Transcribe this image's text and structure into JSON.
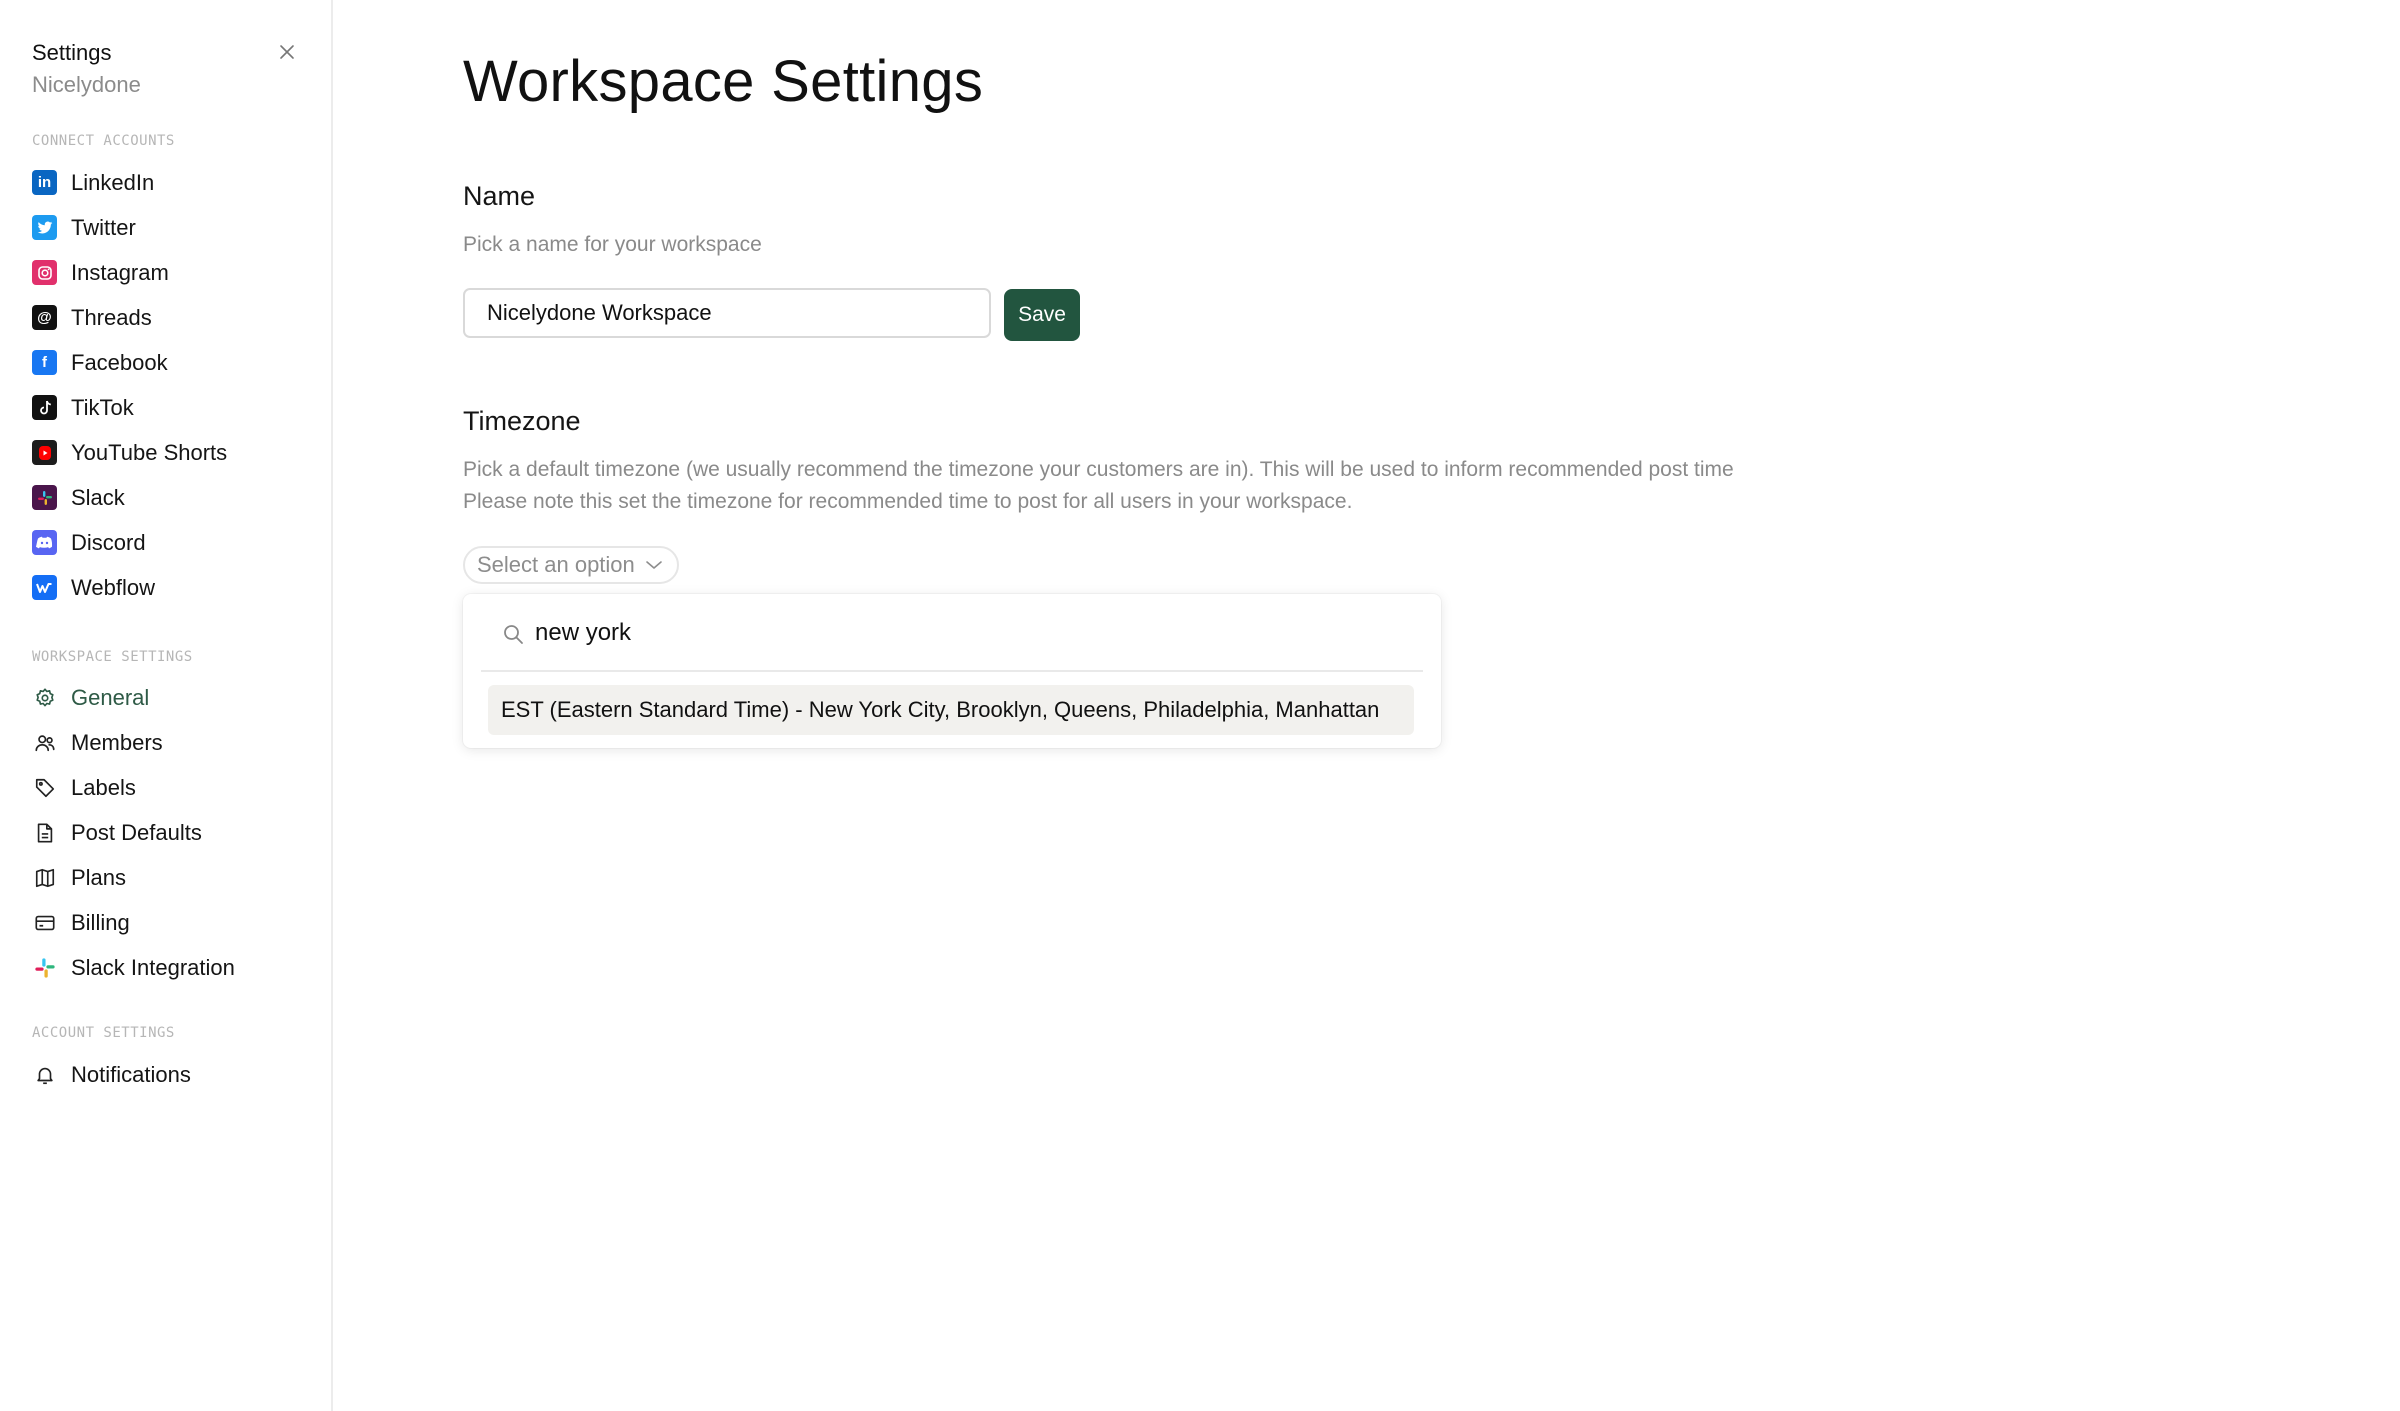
{
  "sidebar": {
    "title": "Settings",
    "subtitle": "Nicelydone",
    "sections": {
      "connect_accounts": "CONNECT ACCOUNTS",
      "workspace_settings": "WORKSPACE SETTINGS",
      "account_settings": "ACCOUNT SETTINGS"
    },
    "connect_items": [
      {
        "label": "LinkedIn",
        "icon": "linkedin-icon",
        "color": "#0a66c2"
      },
      {
        "label": "Twitter",
        "icon": "twitter-icon",
        "color": "#1d9bf0"
      },
      {
        "label": "Instagram",
        "icon": "instagram-icon",
        "color": "#e1306c"
      },
      {
        "label": "Threads",
        "icon": "threads-icon",
        "color": "#111111"
      },
      {
        "label": "Facebook",
        "icon": "facebook-icon",
        "color": "#1877f2"
      },
      {
        "label": "TikTok",
        "icon": "tiktok-icon",
        "color": "#111111"
      },
      {
        "label": "YouTube Shorts",
        "icon": "youtube-shorts-icon",
        "color": "#ff0000"
      },
      {
        "label": "Slack",
        "icon": "slack-icon",
        "color": "#4a154b"
      },
      {
        "label": "Discord",
        "icon": "discord-icon",
        "color": "#5865f2"
      },
      {
        "label": "Webflow",
        "icon": "webflow-icon",
        "color": "#146ef5"
      }
    ],
    "workspace_items": [
      {
        "label": "General",
        "icon": "gear-icon",
        "active": true
      },
      {
        "label": "Members",
        "icon": "users-icon"
      },
      {
        "label": "Labels",
        "icon": "tag-icon"
      },
      {
        "label": "Post Defaults",
        "icon": "document-icon"
      },
      {
        "label": "Plans",
        "icon": "map-icon"
      },
      {
        "label": "Billing",
        "icon": "credit-card-icon"
      },
      {
        "label": "Slack Integration",
        "icon": "slack-color-icon"
      }
    ],
    "account_items": [
      {
        "label": "Notifications",
        "icon": "bell-icon"
      }
    ]
  },
  "main": {
    "title": "Workspace Settings",
    "name_section": {
      "label": "Name",
      "description": "Pick a name for your workspace",
      "input_value": "Nicelydone Workspace",
      "save_label": "Save"
    },
    "timezone_section": {
      "label": "Timezone",
      "description_line1": "Pick a default timezone (we usually recommend the timezone your customers are in). This will be used to inform recommended post time",
      "description_line2": "Please note this set the timezone for recommended time to post for all users in your workspace.",
      "select_placeholder": "Select an option",
      "search_value": "new york",
      "options": [
        "EST (Eastern Standard Time) - New York City, Brooklyn, Queens, Philadelphia, Manhattan"
      ]
    }
  },
  "colors": {
    "accent": "#22553f",
    "active_nav": "#2e5a46",
    "muted_text": "#8a8a8a"
  }
}
